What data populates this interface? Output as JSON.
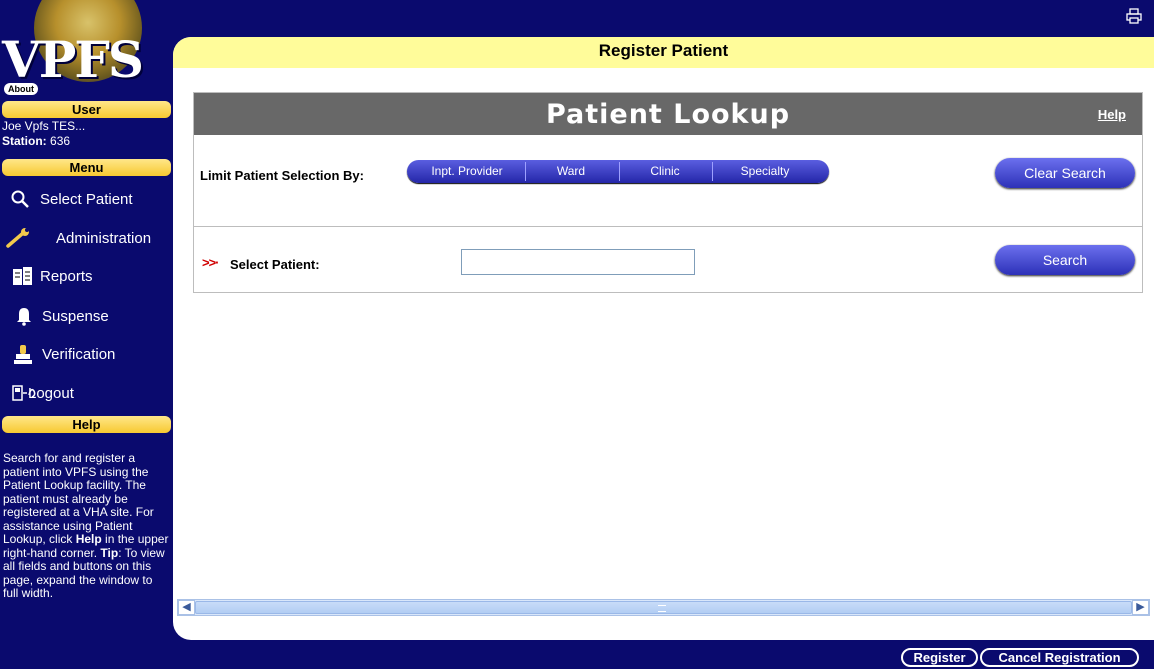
{
  "app": {
    "title": "VPFS",
    "about_label": "About"
  },
  "sidebar": {
    "user_header": "User",
    "user_name": "Joe Vpfs TES...",
    "station_label": "Station:",
    "station_value": "636",
    "menu_header": "Menu",
    "menu_items": [
      {
        "label": "Select Patient",
        "icon": "magnifier-icon"
      },
      {
        "label": "Administration",
        "icon": "wrench-icon"
      },
      {
        "label": "Reports",
        "icon": "reports-icon"
      },
      {
        "label": "Suspense",
        "icon": "bell-icon"
      },
      {
        "label": "Verification",
        "icon": "stamp-icon"
      },
      {
        "label": "Logout",
        "icon": "logout-icon"
      }
    ],
    "help_header": "Help",
    "help_text": {
      "p1": "Search for and register a patient into VPFS using the Patient Lookup facility. The patient must already be registered at a VHA site. For assistance using Patient Lookup, click ",
      "p1_bold": "Help",
      "p1_end": " in the upper right-hand corner.",
      "tip_label": "Tip",
      "tip_text": ": To view all fields and buttons on this page, expand the window to full width."
    }
  },
  "header": {
    "title": "Register Patient",
    "print_icon": "print-icon"
  },
  "lookup": {
    "title": "Patient Lookup",
    "help_link": "Help",
    "limit_label": "Limit Patient Selection By:",
    "limit_buttons": [
      "Inpt. Provider",
      "Ward",
      "Clinic",
      "Specialty"
    ],
    "clear_search_label": "Clear Search",
    "select_arrow": ">>·",
    "select_label": "Select Patient:",
    "patient_input_value": "",
    "search_label": "Search"
  },
  "footer": {
    "register_label": "Register",
    "cancel_label": "Cancel Registration"
  },
  "colors": {
    "navy": "#0a0a6e",
    "gold": "#f7c931",
    "title_yellow": "#fffc9a",
    "lookup_gray": "#686868",
    "button_blue": "#2d31b8"
  }
}
